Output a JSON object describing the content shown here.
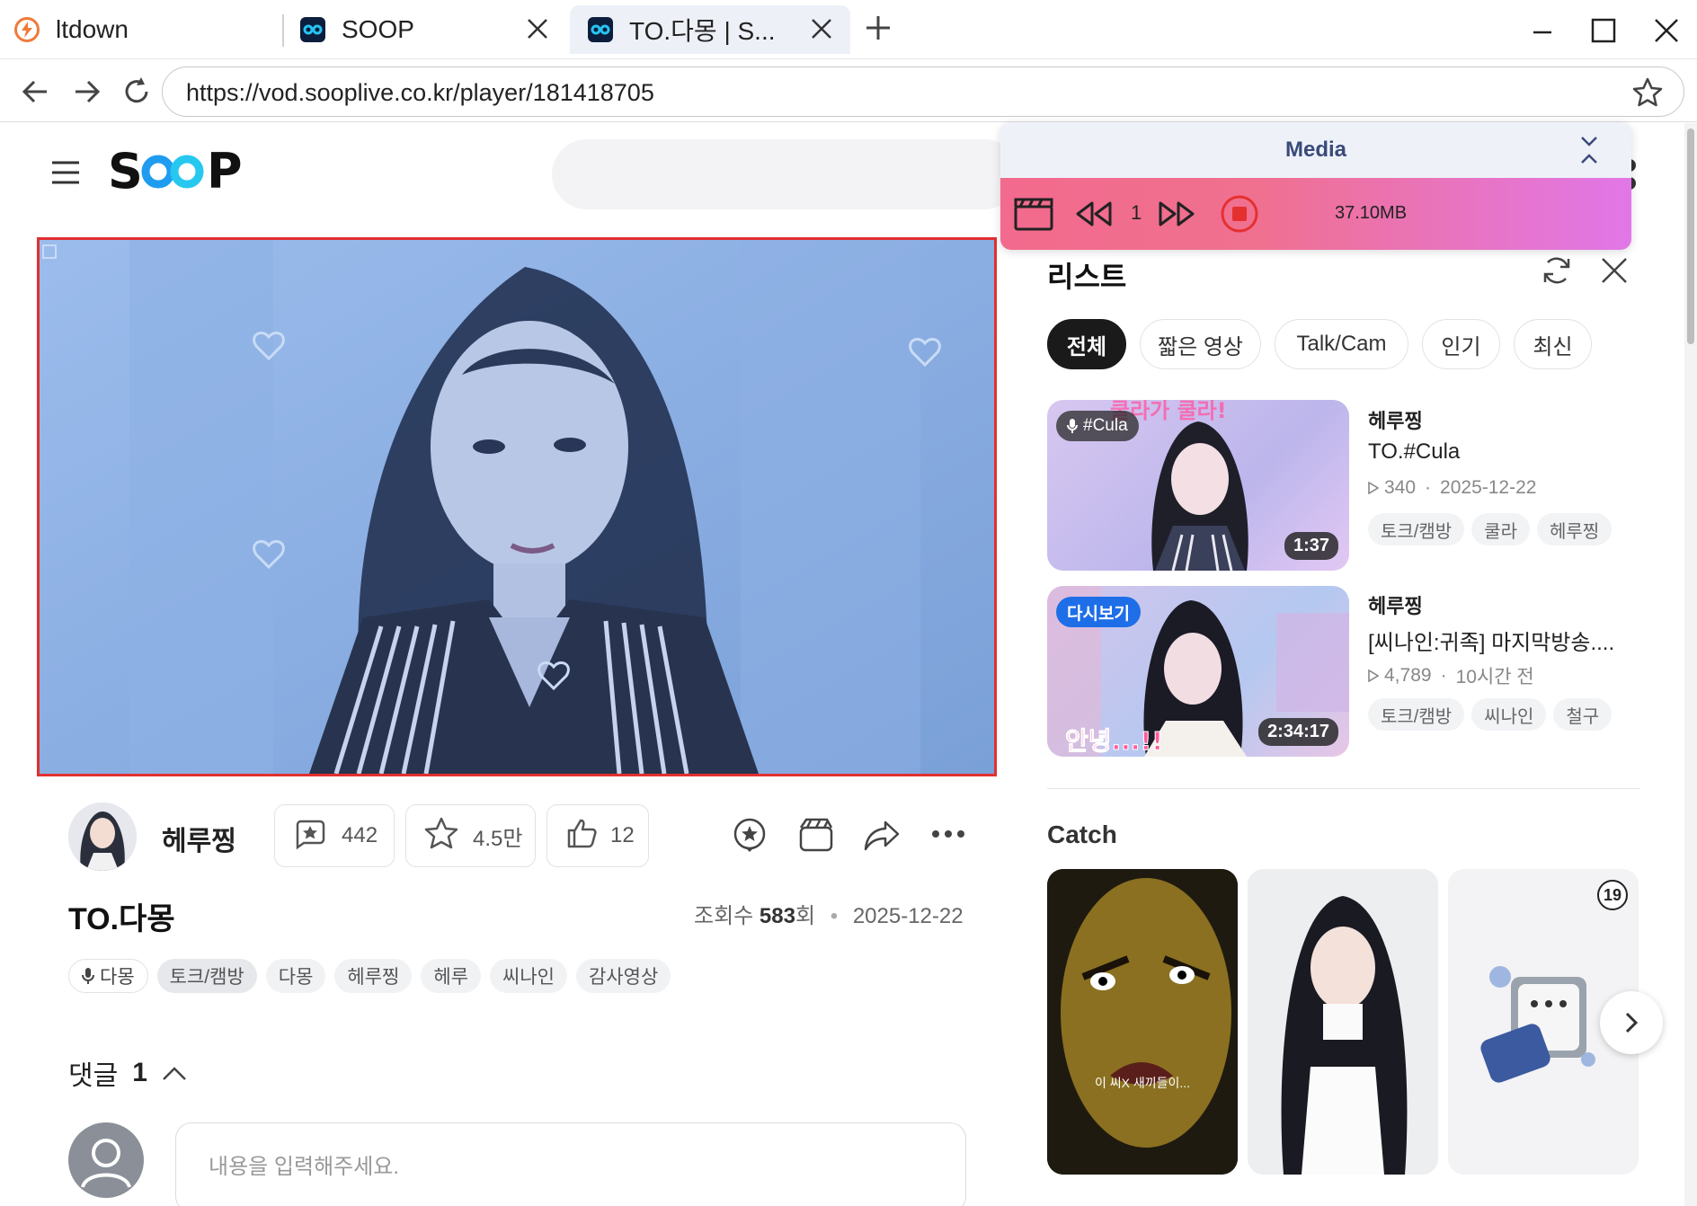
{
  "browser": {
    "tabs": [
      {
        "title": "ltdown"
      },
      {
        "title": "SOOP"
      },
      {
        "title": "TO.다몽 | S..."
      }
    ],
    "url": "https://vod.sooplive.co.kr/player/181418705"
  },
  "media_panel": {
    "title": "Media",
    "count": "1",
    "size": "37.10MB"
  },
  "video": {
    "channel_name": "헤루찡",
    "stat_comments": "442",
    "stat_favorites": "4.5만",
    "stat_likes": "12",
    "title": "TO.다몽",
    "views_label": "조회수",
    "views_value": "583",
    "views_unit": "회",
    "date": "2025-12-22",
    "tags": [
      "토크/캠방",
      "다몽",
      "헤루찡",
      "헤루",
      "씨나인",
      "감사영상"
    ],
    "mic_tag": "다몽"
  },
  "comments": {
    "label": "댓글",
    "count": "1",
    "placeholder": "내용을 입력해주세요."
  },
  "list": {
    "title": "리스트",
    "filters": [
      "전체",
      "짧은 영상",
      "Talk/Cam",
      "인기",
      "최신"
    ],
    "items": [
      {
        "badge": "#Cula",
        "duration": "1:37",
        "channel": "헤루찡",
        "title": "TO.#Cula",
        "views": "340",
        "when": "2025-12-22",
        "tags": [
          "토크/캠방",
          "쿨라",
          "헤루찡"
        ]
      },
      {
        "badge": "다시보기",
        "duration": "2:34:17",
        "channel": "헤루찡",
        "title": "[씨나인:귀족] 마지막방송....",
        "views": "4,789",
        "when": "10시간 전",
        "tags": [
          "토크/캠방",
          "씨나인",
          "철구"
        ]
      }
    ]
  },
  "catch": {
    "title": "Catch",
    "card1_caption": "이 씨X 새끼들이...",
    "card3_badge": "19"
  }
}
